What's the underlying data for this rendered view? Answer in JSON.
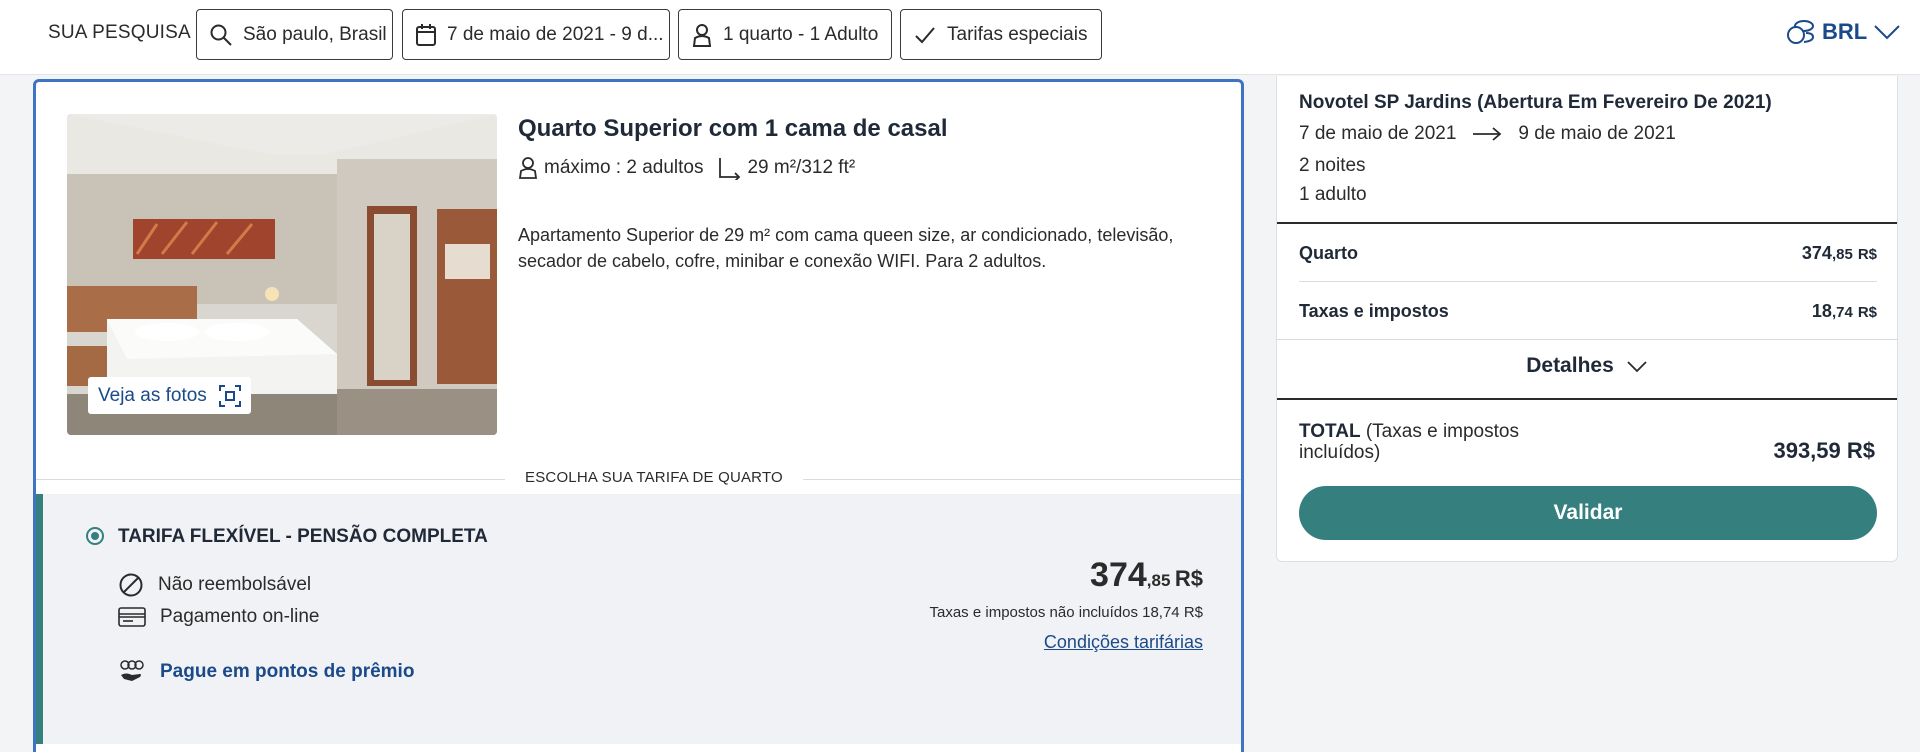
{
  "search": {
    "label": "SUA PESQUISA",
    "location": "São paulo, Brasil",
    "dates": "7 de maio de 2021 - 9 d...",
    "occupancy": "1 quarto - 1 Adulto",
    "special_rates": "Tarifas especiais",
    "currency": "BRL"
  },
  "room": {
    "title": "Quarto Superior com 1 cama de casal",
    "capacity": "máximo : 2 adultos",
    "size": "29 m²/312 ft²",
    "description": "Apartamento Superior de 29 m² com cama queen size, ar condicionado, televisão, secador de cabelo, cofre, minibar e conexão WIFI. Para 2 adultos.",
    "photos_button": "Veja as fotos"
  },
  "rates": {
    "section_label": "ESCOLHA SUA TARIFA DE QUARTO",
    "items": [
      {
        "name": "TARIFA FLEXÍVEL - PENSÃO COMPLETA",
        "feature_1": "Não reembolsável",
        "feature_2": "Pagamento on-line",
        "points": "Pague em pontos de prêmio",
        "price_int": "374",
        "price_cents": ",85",
        "price_currency": "R$",
        "tax_note": "Taxas e impostos não incluídos 18,74 R$",
        "conditions": "Condições tarifárias"
      }
    ]
  },
  "summary": {
    "hotel": "Novotel SP Jardins (Abertura Em Fevereiro De 2021)",
    "checkin": "7 de maio de 2021",
    "checkout": "9 de maio de 2021",
    "nights": "2 noites",
    "adults": "1 adulto",
    "room_label": "Quarto",
    "room_int": "374",
    "room_cents": ",85",
    "room_currency": "R$",
    "taxes_label": "Taxas e impostos",
    "taxes_int": "18",
    "taxes_cents": ",74",
    "taxes_currency": "R$",
    "details": "Detalhes",
    "total_label": "TOTAL",
    "total_note": "(Taxas e impostos incluídos)",
    "total_amount": "393,59 R$",
    "validate": "Validar"
  },
  "colors": {
    "accent_teal": "#357f7f",
    "link_blue": "#1b4a8a",
    "card_border": "#3f73c4"
  }
}
